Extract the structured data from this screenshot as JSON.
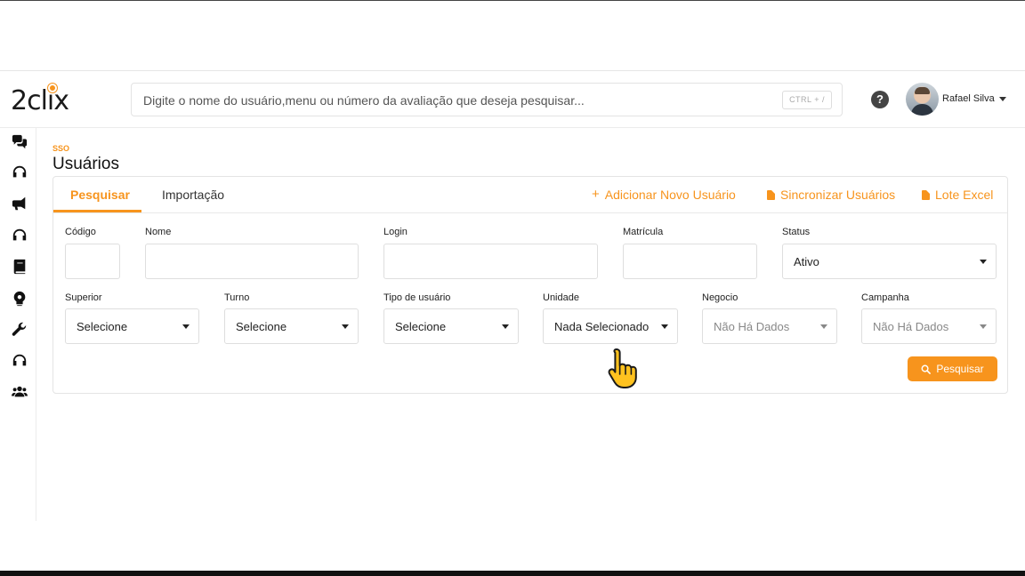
{
  "header": {
    "logo_text": "2clix",
    "search_placeholder": "Digite o nome do usuário,menu ou número da avaliação que deseja pesquisar...",
    "search_shortcut": "CTRL + /",
    "help_glyph": "?",
    "user_name": "Rafael Silva"
  },
  "sidebar": {
    "icons": [
      "chat-icon",
      "headset-icon",
      "megaphone-icon",
      "headset-icon",
      "book-icon",
      "settings-bulb-icon",
      "wrench-icon",
      "headset-icon",
      "users-icon"
    ]
  },
  "page": {
    "breadcrumb": "SSO",
    "title": "Usuários"
  },
  "tabs": {
    "search": "Pesquisar",
    "import": "Importação"
  },
  "actions": {
    "add_user": "Adicionar Novo Usuário",
    "sync_users": "Sincronizar Usuários",
    "batch_excel": "Lote Excel"
  },
  "form": {
    "codigo": {
      "label": "Código",
      "value": ""
    },
    "nome": {
      "label": "Nome",
      "value": ""
    },
    "login": {
      "label": "Login",
      "value": ""
    },
    "matricula": {
      "label": "Matrícula",
      "value": ""
    },
    "status": {
      "label": "Status",
      "value": "Ativo"
    },
    "superior": {
      "label": "Superior",
      "value": "Selecione"
    },
    "turno": {
      "label": "Turno",
      "value": "Selecione"
    },
    "tipo": {
      "label": "Tipo de usuário",
      "value": "Selecione"
    },
    "unidade": {
      "label": "Unidade",
      "value": "Nada Selecionado"
    },
    "negocio": {
      "label": "Negocio",
      "value": "Não Há Dados"
    },
    "campanha": {
      "label": "Campanha",
      "value": "Não Há Dados"
    }
  },
  "search_button": "Pesquisar",
  "colors": {
    "accent": "#f7941d",
    "text": "#222222",
    "border": "#dedede"
  }
}
